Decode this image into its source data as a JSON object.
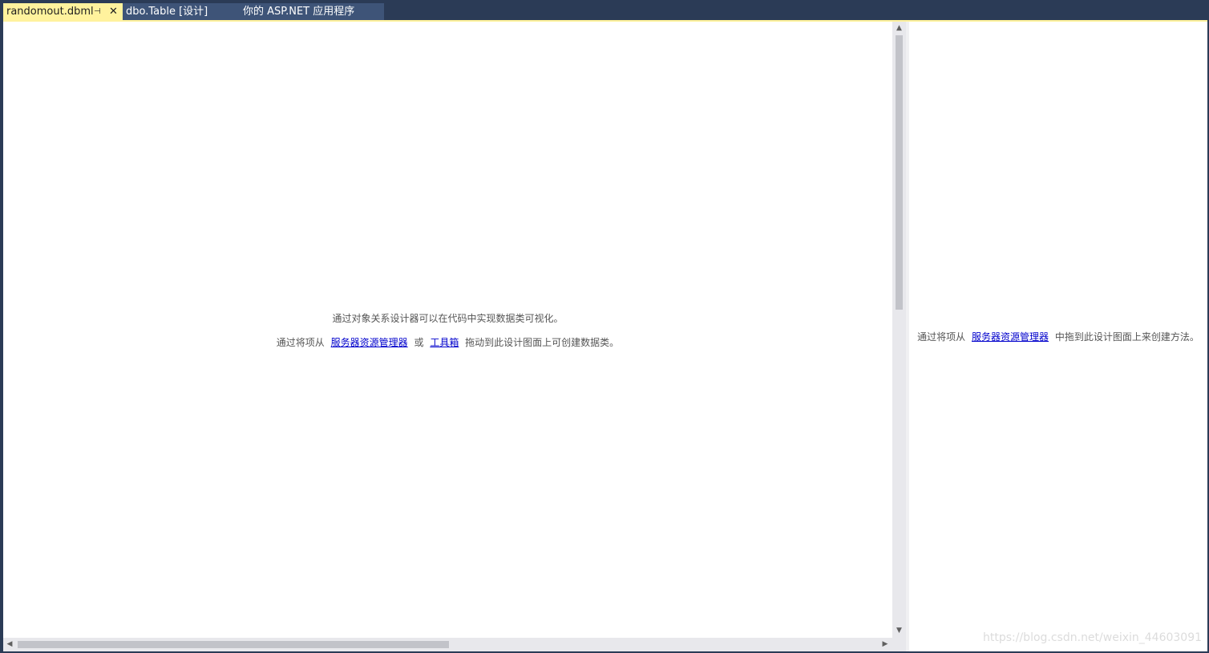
{
  "tabs": [
    {
      "label": "randomout.dbml",
      "pin": "⊣",
      "close": "✕"
    },
    {
      "label": "dbo.Table [设计]"
    },
    {
      "label": "你的 ASP.NET 应用程序"
    }
  ],
  "designer": {
    "line1": "通过对象关系设计器可以在代码中实现数据类可视化。",
    "line2_prefix": "通过将项从",
    "server_explorer_link": "服务器资源管理器",
    "or_text": "或",
    "toolbox_link": "工具箱",
    "line2_suffix": "拖动到此设计图面上可创建数据类。"
  },
  "methods": {
    "prefix": "通过将项从",
    "server_explorer_link": "服务器资源管理器",
    "suffix": "中拖到此设计图面上来创建方法。"
  },
  "scrollbar": {
    "up": "▲",
    "down": "▼",
    "left": "◀",
    "right": "▶"
  },
  "watermark": "https://blog.csdn.net/weixin_44603091",
  "colors": {
    "chrome": "#2b3b56",
    "active_tab": "#fff29d",
    "inactive_tab": "#3e5478",
    "link": "#0000cc"
  }
}
